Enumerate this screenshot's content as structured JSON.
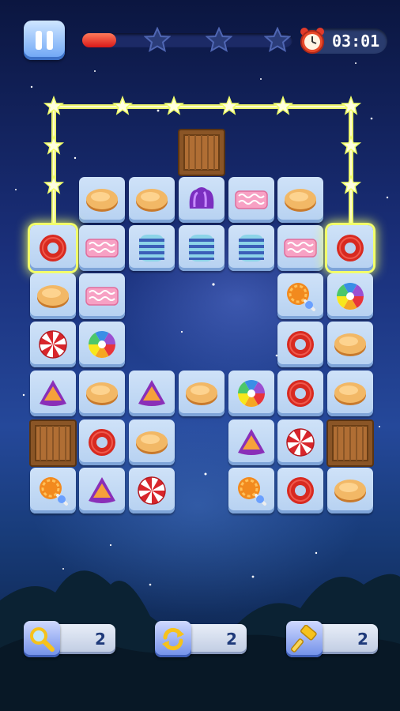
{
  "hud": {
    "timer": "03:01",
    "level_progress": 0.16,
    "stars_earned": 0,
    "stars_total": 3,
    "pause_icon": "pause-icon",
    "clock_icon": "alarm-clock-icon"
  },
  "board": {
    "selected_pair": [
      "r1c0",
      "r1c6"
    ],
    "match_path_color": "#f6ff6e",
    "tiles": [
      {
        "id": "r0c1",
        "kind": "caramel"
      },
      {
        "id": "r0c2",
        "kind": "caramel"
      },
      {
        "id": "r0c3",
        "kind": "purple-jelly"
      },
      {
        "id": "r0c4",
        "kind": "pink-taffy"
      },
      {
        "id": "r0c5",
        "kind": "caramel"
      },
      {
        "id": "r1c0",
        "kind": "red-ring"
      },
      {
        "id": "r1c1",
        "kind": "pink-taffy"
      },
      {
        "id": "r1c2",
        "kind": "striped-marshmallow"
      },
      {
        "id": "r1c3",
        "kind": "striped-marshmallow"
      },
      {
        "id": "r1c4",
        "kind": "striped-marshmallow"
      },
      {
        "id": "r1c5",
        "kind": "pink-taffy"
      },
      {
        "id": "r1c6",
        "kind": "red-ring"
      },
      {
        "id": "r2c0",
        "kind": "caramel"
      },
      {
        "id": "r2c1",
        "kind": "pink-taffy"
      },
      {
        "id": "r2c5",
        "kind": "orange-lollipop"
      },
      {
        "id": "r2c6",
        "kind": "rainbow-swirl"
      },
      {
        "id": "r3c0",
        "kind": "peppermint"
      },
      {
        "id": "r3c1",
        "kind": "rainbow-swirl"
      },
      {
        "id": "r3c5",
        "kind": "red-ring"
      },
      {
        "id": "r3c6",
        "kind": "caramel"
      },
      {
        "id": "r4c0",
        "kind": "triangle-gummy"
      },
      {
        "id": "r4c1",
        "kind": "caramel"
      },
      {
        "id": "r4c2",
        "kind": "triangle-gummy"
      },
      {
        "id": "r4c3",
        "kind": "caramel"
      },
      {
        "id": "r4c4",
        "kind": "rainbow-swirl"
      },
      {
        "id": "r4c5",
        "kind": "red-ring"
      },
      {
        "id": "r4c6",
        "kind": "caramel"
      },
      {
        "id": "r5c1",
        "kind": "red-ring"
      },
      {
        "id": "r5c2",
        "kind": "caramel"
      },
      {
        "id": "r5c4",
        "kind": "triangle-gummy"
      },
      {
        "id": "r5c5",
        "kind": "peppermint"
      },
      {
        "id": "r6c0",
        "kind": "orange-lollipop"
      },
      {
        "id": "r6c1",
        "kind": "triangle-gummy"
      },
      {
        "id": "r6c2",
        "kind": "peppermint"
      },
      {
        "id": "r6c4",
        "kind": "orange-lollipop"
      },
      {
        "id": "r6c5",
        "kind": "red-ring"
      },
      {
        "id": "r6c6",
        "kind": "caramel"
      }
    ],
    "crates": [
      "top-crate",
      "left-crate",
      "right-crate"
    ]
  },
  "boosters": [
    {
      "name": "magnifier",
      "icon": "magnifier-icon",
      "count": "2"
    },
    {
      "name": "shuffle",
      "icon": "shuffle-icon",
      "count": "2"
    },
    {
      "name": "hammer",
      "icon": "hammer-icon",
      "count": "2"
    }
  ]
}
